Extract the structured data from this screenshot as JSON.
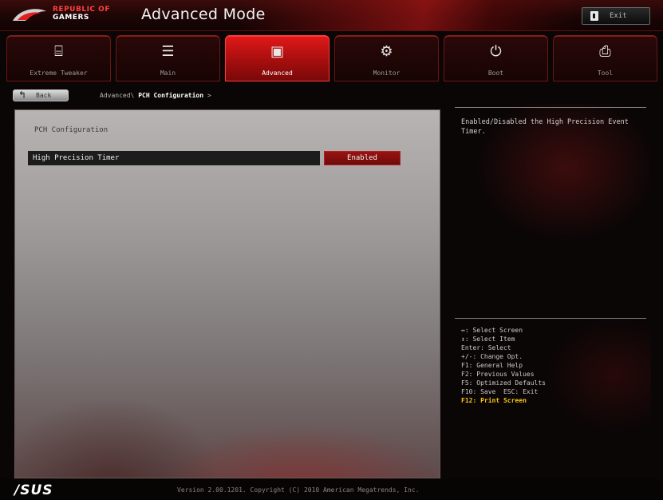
{
  "header": {
    "brand_line1": "REPUBLIC OF",
    "brand_line2": "GAMERS",
    "mode_title": "Advanced Mode",
    "exit_label": "Exit",
    "accent_color": "#c81a1a"
  },
  "tabs": [
    {
      "label": "Extreme Tweaker",
      "icon": "extreme-tweaker-icon",
      "glyph": "⌸",
      "active": false
    },
    {
      "label": "Main",
      "icon": "list-icon",
      "glyph": "☰",
      "active": false
    },
    {
      "label": "Advanced",
      "icon": "advanced-chip-icon",
      "glyph": "▣",
      "active": true
    },
    {
      "label": "Monitor",
      "icon": "monitor-fan-icon",
      "glyph": "⚙",
      "active": false
    },
    {
      "label": "Boot",
      "icon": "power-icon",
      "glyph": "⏻",
      "active": false
    },
    {
      "label": "Tool",
      "icon": "printer-tool-icon",
      "glyph": "⎙",
      "active": false
    }
  ],
  "breadcrumb": {
    "back_label": "Back",
    "path_prefix": "Advanced\\",
    "path_current": "PCH Configuration",
    "path_suffix": ">"
  },
  "main": {
    "section_title": "PCH Configuration",
    "setting_label": "High Precision Timer",
    "setting_value": "Enabled"
  },
  "help": {
    "description": "Enabled/Disabled the High Precision Event Timer.",
    "keys": [
      "↔: Select Screen",
      "↕: Select Item",
      "Enter: Select",
      "+/-: Change Opt.",
      "F1: General Help",
      "F2: Previous Values",
      "F5: Optimized Defaults",
      "F10: Save  ESC: Exit"
    ],
    "highlight_key": "F12: Print Screen"
  },
  "footer": {
    "logo": "/SUS",
    "version_text": "Version 2.00.1201. Copyright (C) 2010 American Megatrends, Inc."
  }
}
